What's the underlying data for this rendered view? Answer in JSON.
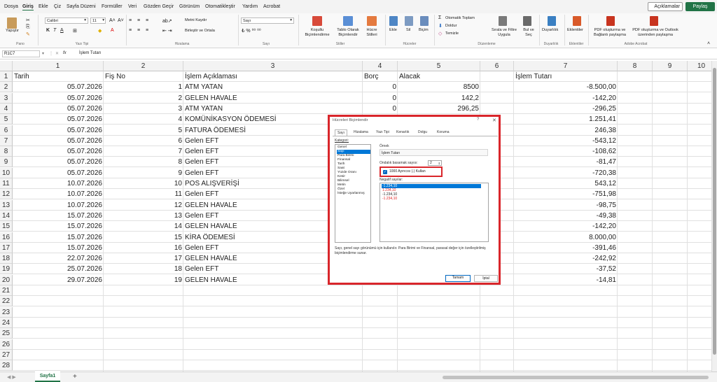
{
  "menu": {
    "items": [
      "Dosya",
      "Giriş",
      "Ekle",
      "Çiz",
      "Sayfa Düzeni",
      "Formüller",
      "Veri",
      "Gözden Geçir",
      "Görünüm",
      "Otomatikleştir",
      "Yardım",
      "Acrobat"
    ],
    "active": "Giriş",
    "comments_label": "Açıklamalar",
    "share_label": "Paylaş"
  },
  "ribbon": {
    "paste_label": "Yapıştır",
    "font_name": "Calibri",
    "font_size": "11",
    "wrap_text": "Metni Kaydır",
    "merge_center": "Birleştir ve Ortala",
    "number_format": "Sayı",
    "conditional_format": "Koşullu Biçimlendirme",
    "format_as_table": "Tablo Olarak Biçimlendir",
    "cell_styles": "Hücre Stilleri",
    "insert": "Ekle",
    "delete": "Sil",
    "format": "Biçim",
    "autosum": "Otomatik Toplam",
    "fill": "Doldur",
    "clear": "Temizle",
    "sort_filter": "Sırala ve Filtre Uygula",
    "find_select": "Bul ve Seç",
    "sensitivity": "Duyarlılık",
    "addins": "Eklentiler",
    "pdf_link": "PDF oluşturma ve Bağlantı paylaşma",
    "pdf_outlook": "PDF oluşturma ve Outlook üzerinden paylaşma",
    "groups": {
      "clipboard": "Pano",
      "font": "Yazı Tipi",
      "alignment": "Hizalama",
      "number": "Sayı",
      "styles": "Stiller",
      "cells": "Hücreler",
      "editing": "Düzenleme",
      "sensitivity": "Duyarlılık",
      "addins": "Eklentiler",
      "acrobat": "Adobe Acrobat"
    }
  },
  "formula_bar": {
    "name_box": "R1C7",
    "fx": "fx",
    "value": "İşlem Tutarı"
  },
  "grid": {
    "columns": [
      "1",
      "2",
      "3",
      "4",
      "5",
      "6",
      "7",
      "8",
      "9",
      "10"
    ],
    "rows": [
      "1",
      "2",
      "3",
      "4",
      "5",
      "6",
      "7",
      "8",
      "9",
      "10",
      "11",
      "12",
      "13",
      "14",
      "15",
      "16",
      "17",
      "18",
      "19",
      "20",
      "21",
      "22",
      "23",
      "24",
      "25",
      "26",
      "27",
      "28"
    ],
    "headers": {
      "tarih": "Tarih",
      "fis_no": "Fiş No",
      "aciklama": "İşlem Açıklaması",
      "borc": "Borç",
      "alacak": "Alacak",
      "tutar": "İşlem Tutarı"
    },
    "data": [
      {
        "tarih": "05.07.2026",
        "fis": "1",
        "aciklama": "ATM YATAN",
        "borc": "0",
        "alacak": "8500",
        "tutar": "-8.500,00"
      },
      {
        "tarih": "05.07.2026",
        "fis": "2",
        "aciklama": "GELEN HAVALE",
        "borc": "0",
        "alacak": "142,2",
        "tutar": "-142,20"
      },
      {
        "tarih": "05.07.2026",
        "fis": "3",
        "aciklama": "ATM YATAN",
        "borc": "0",
        "alacak": "296,25",
        "tutar": "-296,25"
      },
      {
        "tarih": "05.07.2026",
        "fis": "4",
        "aciklama": "KOMÜNİKASYON ÖDEMESİ",
        "borc": "",
        "alacak": "",
        "tutar": "1.251,41"
      },
      {
        "tarih": "05.07.2026",
        "fis": "5",
        "aciklama": "FATURA ÖDEMESİ",
        "borc": "",
        "alacak": "",
        "tutar": "246,38"
      },
      {
        "tarih": "05.07.2026",
        "fis": "6",
        "aciklama": "Gelen EFT",
        "borc": "",
        "alacak": "",
        "tutar": "-543,12"
      },
      {
        "tarih": "05.07.2026",
        "fis": "7",
        "aciklama": "Gelen EFT",
        "borc": "",
        "alacak": "",
        "tutar": "-108,62"
      },
      {
        "tarih": "05.07.2026",
        "fis": "8",
        "aciklama": "Gelen EFT",
        "borc": "",
        "alacak": "",
        "tutar": "-81,47"
      },
      {
        "tarih": "05.07.2026",
        "fis": "9",
        "aciklama": "Gelen EFT",
        "borc": "",
        "alacak": "",
        "tutar": "-720,38"
      },
      {
        "tarih": "10.07.2026",
        "fis": "10",
        "aciklama": "POS ALIŞVERİŞİ",
        "borc": "",
        "alacak": "",
        "tutar": "543,12"
      },
      {
        "tarih": "10.07.2026",
        "fis": "11",
        "aciklama": "Gelen EFT",
        "borc": "",
        "alacak": "",
        "tutar": "-751,98"
      },
      {
        "tarih": "10.07.2026",
        "fis": "12",
        "aciklama": "GELEN HAVALE",
        "borc": "",
        "alacak": "",
        "tutar": "-98,75"
      },
      {
        "tarih": "15.07.2026",
        "fis": "13",
        "aciklama": "Gelen EFT",
        "borc": "",
        "alacak": "",
        "tutar": "-49,38"
      },
      {
        "tarih": "15.07.2026",
        "fis": "14",
        "aciklama": "GELEN HAVALE",
        "borc": "",
        "alacak": "",
        "tutar": "-142,20"
      },
      {
        "tarih": "15.07.2026",
        "fis": "15",
        "aciklama": "KİRA ÖDEMESİ",
        "borc": "",
        "alacak": "",
        "tutar": "8.000,00"
      },
      {
        "tarih": "15.07.2026",
        "fis": "16",
        "aciklama": "Gelen EFT",
        "borc": "",
        "alacak": "",
        "tutar": "-391,46"
      },
      {
        "tarih": "22.07.2026",
        "fis": "17",
        "aciklama": "GELEN HAVALE",
        "borc": "",
        "alacak": "",
        "tutar": "-242,92"
      },
      {
        "tarih": "25.07.2026",
        "fis": "18",
        "aciklama": "Gelen EFT",
        "borc": "",
        "alacak": "",
        "tutar": "-37,52"
      },
      {
        "tarih": "29.07.2026",
        "fis": "19",
        "aciklama": "GELEN HAVALE",
        "borc": "0",
        "alacak": "14,81",
        "tutar": "-14,81"
      }
    ]
  },
  "sheet_tabs": {
    "active": "Sayfa1",
    "add": "+"
  },
  "dialog": {
    "title": "Hücreleri Biçimlendir",
    "help": "?",
    "close": "✕",
    "tabs": [
      "Sayı",
      "Hizalama",
      "Yazı Tipi",
      "Kenarlık",
      "Dolgu",
      "Koruma"
    ],
    "active_tab": "Sayı",
    "category_label": "Kategori:",
    "categories": [
      "Genel",
      "Sayı",
      "Para Birimi",
      "Finansal",
      "Tarih",
      "Saat",
      "Yüzde Oranı",
      "Kesir",
      "Bilimsel",
      "Metin",
      "Özel",
      "İsteğe Uyarlanmış"
    ],
    "selected_category": "Sayı",
    "sample_label": "Örnek",
    "sample_value": "İşlem Tutarı",
    "decimal_label": "Ondalık basamak sayısı:",
    "decimal_value": "2",
    "thousands_sep": "1000 Ayırıcısı (.) Kullan",
    "thousands_checked": true,
    "negative_label": "Negatif sayılar:",
    "negative_formats": [
      {
        "text": "-1.234,10",
        "red": false
      },
      {
        "text": "1.234,10",
        "red": true
      },
      {
        "text": "-1.234,10",
        "red": false
      },
      {
        "text": "-1.234,10",
        "red": true
      }
    ],
    "selected_negative": 0,
    "description": "Sayı, genel sayı görünümü için kullanılır. Para Birimi ve Finansal, parasal değer için özelleştirilmiş biçimlendirme sunar.",
    "ok_label": "Tamam",
    "cancel_label": "İptal",
    "highlight_color": "#d9262b"
  },
  "colors": {
    "excel_green": "#217346",
    "selection_blue": "#0078d7"
  }
}
